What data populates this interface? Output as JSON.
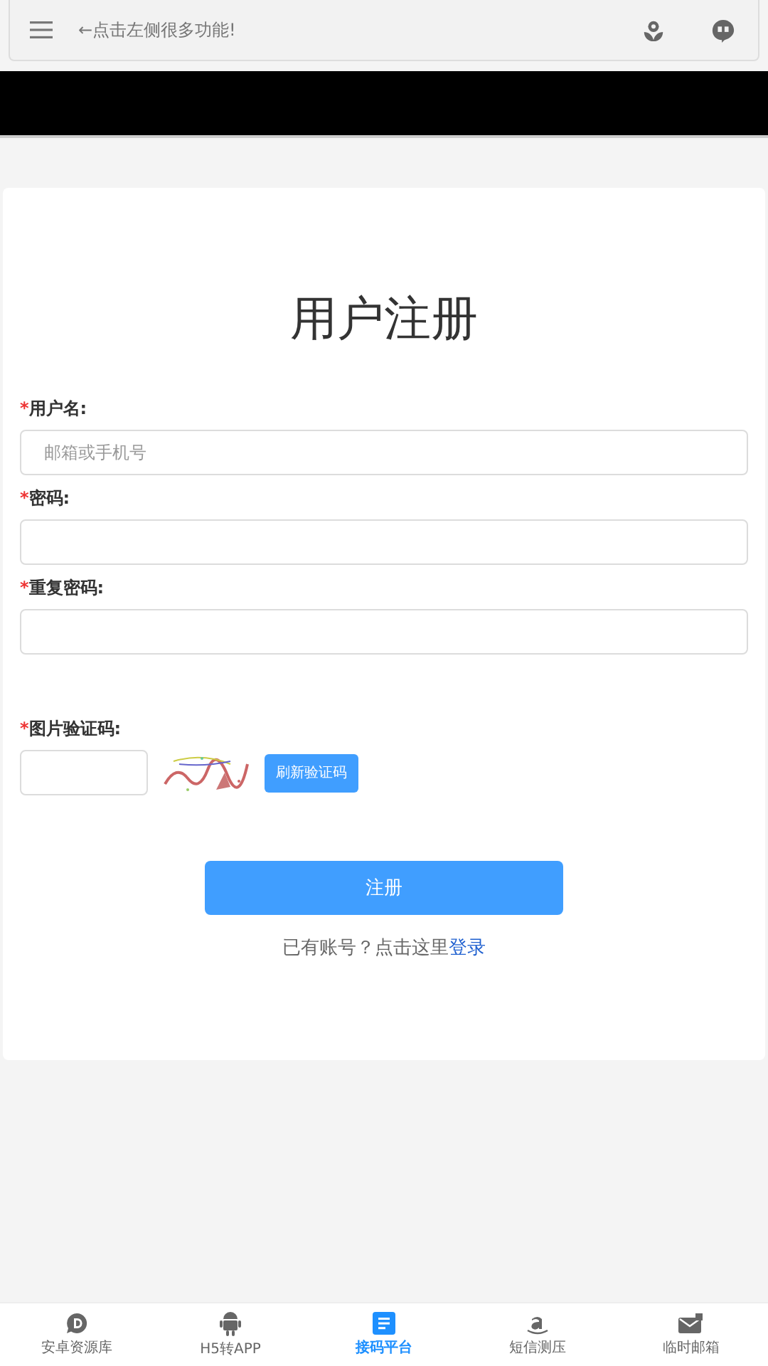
{
  "top_bar": {
    "title": "←点击左侧很多功能!"
  },
  "form": {
    "title": "用户注册",
    "fields": [
      {
        "kind": "text",
        "required_mark": "*",
        "label": "用户名:",
        "placeholder": "邮箱或手机号"
      },
      {
        "kind": "text",
        "required_mark": "*",
        "label": "密码:"
      },
      {
        "kind": "text",
        "required_mark": "*",
        "label": "重复密码:"
      },
      {
        "kind": "captcha",
        "required_mark": "*",
        "label": "图片验证码:",
        "button": "刷新验证码"
      }
    ],
    "submit": "注册",
    "login_prompt": "已有账号？点击这里",
    "login_link": "登录"
  },
  "bottom_nav": [
    {
      "label": "安卓资源库",
      "kind": "d",
      "selected": false
    },
    {
      "label": "H5转APP",
      "kind": "android",
      "selected": false
    },
    {
      "label": "接码平台",
      "kind": "doc",
      "selected": true
    },
    {
      "label": "短信测压",
      "kind": "a",
      "selected": false
    },
    {
      "label": "临时邮箱",
      "kind": "mail",
      "selected": false
    }
  ]
}
